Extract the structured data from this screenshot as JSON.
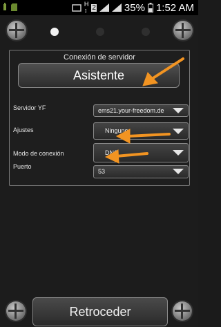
{
  "status_bar": {
    "battery": "35%",
    "time": "1:52 AM"
  },
  "panel": {
    "title": "Conexión de servidor",
    "wizard_label": "Asistente",
    "rows": [
      {
        "label": "Servidor YF",
        "value": "ems21.your-freedom.de"
      },
      {
        "label": "Ajustes",
        "value": "Ninguno"
      },
      {
        "label": "Modo de conexión",
        "value": "DNS"
      },
      {
        "label": "Puerto",
        "value": "53"
      }
    ]
  },
  "back_label": "Retroceder",
  "page_indicator": {
    "current": 1,
    "total": 3
  },
  "colors": {
    "accent_arrow": "#f29422",
    "background": "#1c1c1c"
  }
}
